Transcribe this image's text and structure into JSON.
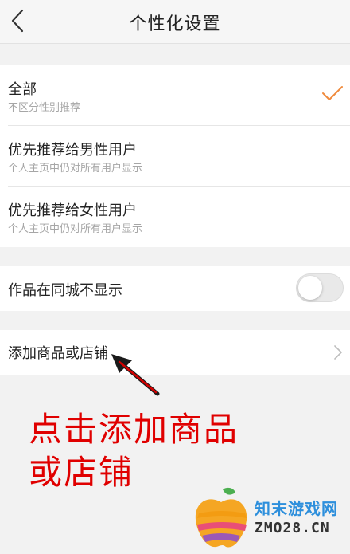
{
  "header": {
    "title": "个性化设置"
  },
  "recommend": {
    "options": [
      {
        "title": "全部",
        "subtitle": "不区分性别推荐",
        "selected": true
      },
      {
        "title": "优先推荐给男性用户",
        "subtitle": "个人主页中仍对所有用户显示",
        "selected": false
      },
      {
        "title": "优先推荐给女性用户",
        "subtitle": "个人主页中仍对所有用户显示",
        "selected": false
      }
    ]
  },
  "local_hide": {
    "label": "作品在同城不显示",
    "enabled": false
  },
  "add_product": {
    "label": "添加商品或店铺"
  },
  "annotation": {
    "line1": "点击添加商品",
    "line2": "或店铺"
  },
  "watermark": {
    "text1": "知末游戏网",
    "text2": "ZMO28.CN"
  },
  "colors": {
    "accent": "#f08a3c",
    "annotation": "#e00000"
  }
}
